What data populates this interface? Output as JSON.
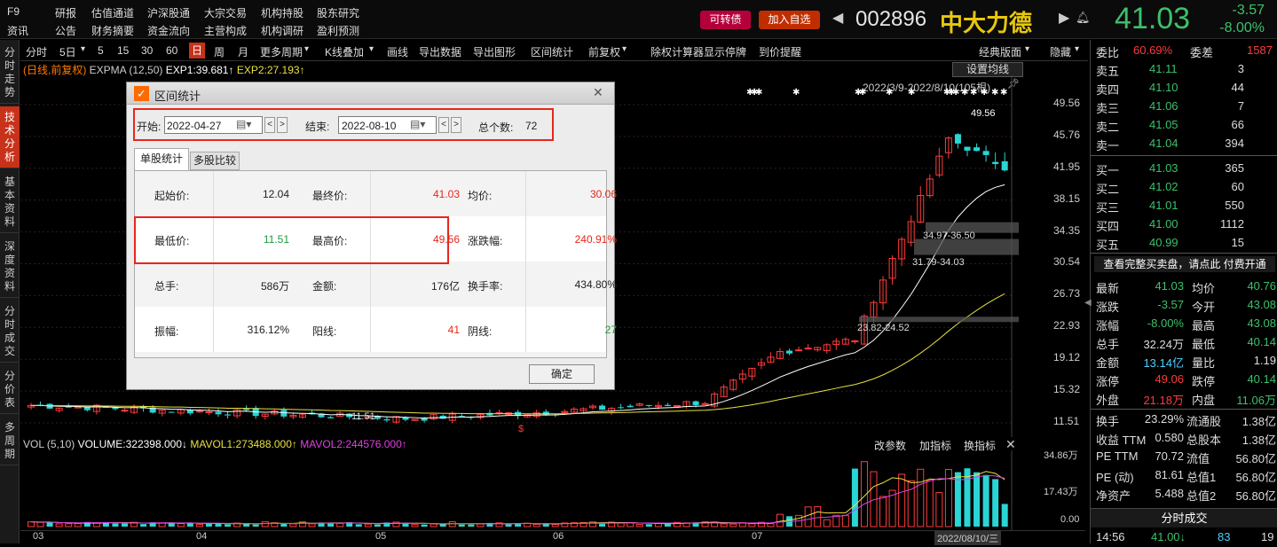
{
  "menu": {
    "row1": [
      "F9",
      "研报",
      "估值通道",
      "沪深股通",
      "大宗交易",
      "机构持股",
      "股东研究"
    ],
    "row2": [
      "资讯",
      "公告",
      "财务摘要",
      "资金流向",
      "主营构成",
      "机构调研",
      "盈利预测"
    ]
  },
  "header": {
    "convertible": "可转债",
    "add_watch": "加入自选",
    "code": "002896",
    "name": "中大力德",
    "last": "41.03",
    "change": "-3.57",
    "change_pct": "-8.00%"
  },
  "left_tabs": [
    "分时走势",
    "技术分析",
    "基本资料",
    "深度资料",
    "分时成交",
    "分价表",
    "多周期"
  ],
  "toolbar": [
    "分时",
    "5日",
    "5",
    "15",
    "30",
    "60",
    "日",
    "周",
    "月",
    "更多周期",
    "K线叠加",
    "画线",
    "导出数据",
    "导出图形",
    "区间统计",
    "前复权",
    "除权计算器",
    "显示停牌",
    "到价提醒"
  ],
  "toolbar_right": [
    "经典版面",
    "隐藏"
  ],
  "active_tool": "日",
  "ema_line": {
    "mode": "(日线,前复权)",
    "name": "EXPMA",
    "params": "(12,50)",
    "exp1": "EXP1:39.681↑",
    "exp2": "EXP2:27.193↑"
  },
  "chart_buttons": {
    "ma_setting": "设置均线"
  },
  "chart_range": "2022/3/9-2022/8/10(105根)",
  "annotations": {
    "high": "49.56",
    "low": "11.51",
    "gap1": "34.97-36.50",
    "gap2": "31.79-34.03",
    "gap3": "23.82-24.52",
    "marker": "$"
  },
  "price_axis": [
    "49.56",
    "45.76",
    "41.95",
    "38.15",
    "34.35",
    "30.54",
    "26.73",
    "22.93",
    "19.12",
    "15.32",
    "11.51"
  ],
  "volume": {
    "title": "VOL (5,10)",
    "vol": "VOLUME:322398.000↓",
    "mavol1": "MAVOL1:273488.000↑",
    "mavol2": "MAVOL2:244576.000↑",
    "buttons": [
      "改参数",
      "加指标",
      "换指标"
    ],
    "axis": [
      "34.86万",
      "17.43万",
      "0.00"
    ]
  },
  "x_axis": [
    {
      "label": "03"
    },
    {
      "label": "04"
    },
    {
      "label": "05"
    },
    {
      "label": "06"
    },
    {
      "label": "07"
    },
    {
      "label": "2022/08/10/三"
    }
  ],
  "dialog": {
    "title": "区间统计",
    "start_label": "开始:",
    "start": "2022-04-27",
    "end_label": "结束:",
    "end": "2022-08-10",
    "count_label": "总个数:",
    "count": "72",
    "tabs": [
      "单股统计",
      "多股比较"
    ],
    "ok": "确定",
    "rows": [
      [
        {
          "k": "起始价:",
          "v": "12.04",
          "c": "wht"
        },
        {
          "k": "最终价:",
          "v": "41.03",
          "c": "red"
        },
        {
          "k": "均价:",
          "v": "30.06",
          "c": "red"
        }
      ],
      [
        {
          "k": "最低价:",
          "v": "11.51",
          "c": "grn"
        },
        {
          "k": "最高价:",
          "v": "49.56",
          "c": "red"
        },
        {
          "k": "涨跌幅:",
          "v": "240.91%",
          "c": "red"
        }
      ],
      [
        {
          "k": "总手:",
          "v": "586万",
          "c": "wht"
        },
        {
          "k": "金额:",
          "v": "176亿",
          "c": "wht"
        },
        {
          "k": "换手率:",
          "v": "434.80%",
          "c": "wht"
        }
      ],
      [
        {
          "k": "振幅:",
          "v": "316.12%",
          "c": "wht"
        },
        {
          "k": "阳线:",
          "v": "41",
          "c": "red"
        },
        {
          "k": "阴线:",
          "v": "27",
          "c": "grn"
        }
      ]
    ]
  },
  "orderbook": {
    "weibi": "委比",
    "weibi_v": "60.69%",
    "weicha": "委差",
    "weicha_v": "1587",
    "asks": [
      {
        "k": "卖五",
        "p": "41.11",
        "q": "3"
      },
      {
        "k": "卖四",
        "p": "41.10",
        "q": "44"
      },
      {
        "k": "卖三",
        "p": "41.06",
        "q": "7"
      },
      {
        "k": "卖二",
        "p": "41.05",
        "q": "66"
      },
      {
        "k": "卖一",
        "p": "41.04",
        "q": "394"
      }
    ],
    "bids": [
      {
        "k": "买一",
        "p": "41.03",
        "q": "365"
      },
      {
        "k": "买二",
        "p": "41.02",
        "q": "60"
      },
      {
        "k": "买三",
        "p": "41.01",
        "q": "550"
      },
      {
        "k": "买四",
        "p": "41.00",
        "q": "1112"
      },
      {
        "k": "买五",
        "p": "40.99",
        "q": "15"
      }
    ],
    "promo": "查看完整买卖盘，请点此 付费开通"
  },
  "quote": [
    {
      "k": "最新",
      "v": "41.03",
      "c": "grn",
      "k2": "均价",
      "v2": "40.76",
      "c2": "grn"
    },
    {
      "k": "涨跌",
      "v": "-3.57",
      "c": "grn",
      "k2": "今开",
      "v2": "43.08",
      "c2": "grn"
    },
    {
      "k": "涨幅",
      "v": "-8.00%",
      "c": "grn",
      "k2": "最高",
      "v2": "43.08",
      "c2": "grn"
    },
    {
      "k": "总手",
      "v": "32.24万",
      "c": "wht",
      "k2": "最低",
      "v2": "40.14",
      "c2": "grn"
    },
    {
      "k": "金额",
      "v": "13.14亿",
      "c": "cyan",
      "k2": "量比",
      "v2": "1.19",
      "c2": "wht"
    },
    {
      "k": "涨停",
      "v": "49.06",
      "c": "red",
      "k2": "跌停",
      "v2": "40.14",
      "c2": "grn"
    },
    {
      "k": "外盘",
      "v": "21.18万",
      "c": "red",
      "k2": "内盘",
      "v2": "11.06万",
      "c2": "grn"
    }
  ],
  "quote2": [
    {
      "k": "换手",
      "v": "23.29%",
      "k2": "流通股",
      "v2": "1.38亿"
    },
    {
      "k": "收益 TTM",
      "v": "0.580",
      "k2": "总股本",
      "v2": "1.38亿"
    },
    {
      "k": "PE TTM",
      "v": "70.72",
      "k2": "流值",
      "v2": "56.80亿"
    },
    {
      "k": "PE (动)",
      "v": "81.61",
      "k2": "总值1",
      "v2": "56.80亿"
    },
    {
      "k": "净资产",
      "v": "5.488",
      "k2": "总值2",
      "v2": "56.80亿"
    }
  ],
  "ticks": {
    "title": "分时成交",
    "time": "14:56",
    "price": "41.00↓",
    "vol": "83",
    "num": "19"
  },
  "colors": {
    "up": "#ff3b3b",
    "down": "#3cc16a",
    "accent": "#c8311a",
    "highlight": "#e8261a"
  },
  "chart_data": {
    "type": "candlestick",
    "ylim": [
      11.51,
      49.56
    ],
    "high": 49.56,
    "low": 11.51,
    "last": 41.03,
    "volume_ylim": [
      0,
      348600
    ]
  }
}
